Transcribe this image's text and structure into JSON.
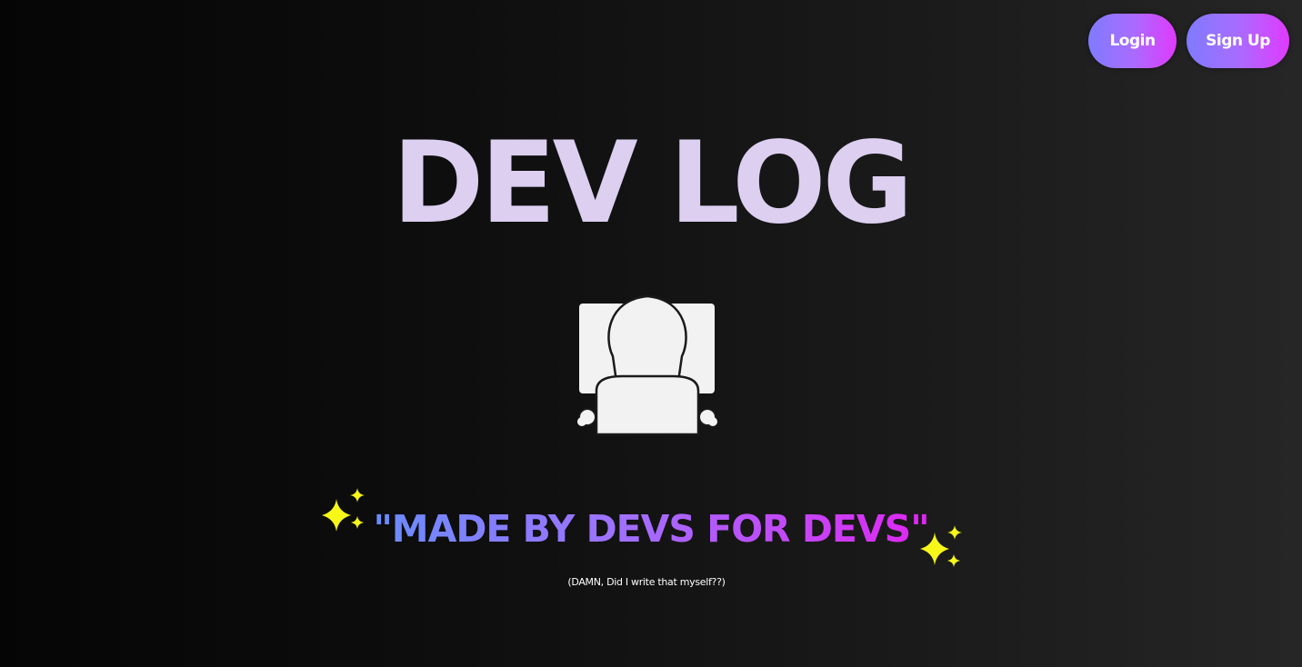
{
  "nav": {
    "login_label": "Login",
    "signup_label": "Sign Up"
  },
  "hero": {
    "title": "DEV LOG",
    "illustration_icon": "developer-at-laptop-icon",
    "tagline": "\"MADE BY DEVS FOR DEVS\"",
    "subtext": "(DAMN, Did I write that myself??)",
    "sparkle_icon": "sparkles-icon"
  },
  "colors": {
    "title": "#dccff0",
    "button_gradient_start": "#7f7bff",
    "button_gradient_end": "#e03aff",
    "tagline_gradient_start": "#6a8cff",
    "tagline_gradient_end": "#e026f2",
    "sparkle": "#f7f71a",
    "illustration": "#f2f2f2"
  }
}
